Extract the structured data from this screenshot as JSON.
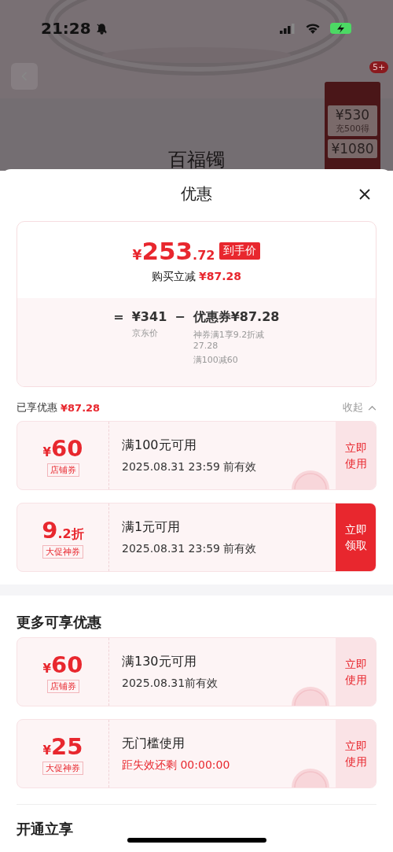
{
  "status_bar": {
    "time": "21:28"
  },
  "background": {
    "cart_badge": "5+",
    "side_card": {
      "offers": [
        {
          "amount": "¥530",
          "note": "充500得"
        },
        {
          "amount": "¥1080"
        }
      ]
    },
    "product_title": "百福镯"
  },
  "sheet": {
    "title": "优惠"
  },
  "summary": {
    "price": {
      "currency": "¥",
      "integer": "253",
      "decimal": ".72"
    },
    "price_tag": "到手价",
    "saving_label": "购买立减",
    "saving_amount": "¥87.28",
    "formula": {
      "equals": "=",
      "base_price": "¥341",
      "minus": "−",
      "coupon_label": "优惠券",
      "coupon_amount": "¥87.28",
      "base_note": "京东价",
      "coupon_notes": [
        "神券满1享9.2折减27.28",
        "满100减60"
      ]
    }
  },
  "enjoyed": {
    "label": "已享优惠",
    "amount": "¥87.28",
    "toggle": "收起",
    "expanded": true
  },
  "enjoyed_coupons": [
    {
      "kind": "amount",
      "currency": "¥",
      "amount": "60",
      "type_tag": "店铺券",
      "condition": "满100元可用",
      "validity": "2025.08.31 23:59 前有效",
      "urgent": false,
      "claimed": true,
      "action": "立即使用"
    },
    {
      "kind": "discount",
      "amount": "9",
      "decimal": ".2",
      "unit": "折",
      "type_tag": "大促神券",
      "condition": "满1元可用",
      "validity": "2025.08.31 23:59 前有效",
      "urgent": false,
      "claimed": false,
      "action": "立即领取"
    }
  ],
  "more": {
    "title": "更多可享优惠"
  },
  "more_coupons": [
    {
      "kind": "amount",
      "currency": "¥",
      "amount": "60",
      "type_tag": "店铺券",
      "condition": "满130元可用",
      "validity": "2025.08.31前有效",
      "urgent": false,
      "claimed": true,
      "action": "立即使用"
    },
    {
      "kind": "amount",
      "currency": "¥",
      "amount": "25",
      "type_tag": "大促神券",
      "condition": "无门槛使用",
      "validity": "距失效还剩 00:00:00",
      "urgent": true,
      "claimed": true,
      "action": "立即使用"
    }
  ],
  "membership": {
    "title": "开通立享"
  }
}
